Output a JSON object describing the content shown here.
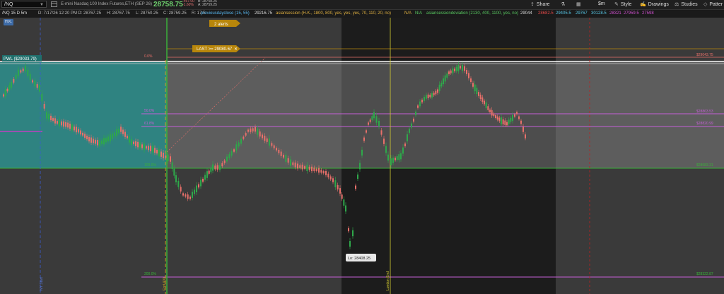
{
  "toolbar": {
    "symbol": "/NQ",
    "title": "E-mini Nasdaq 100 Index Futures,ETH (SEP 26)",
    "last_price": "28758.75",
    "net_change": "-467.00",
    "pct_change": "-1.60%",
    "bid": "B: 28758.25",
    "ask": "A: 28759.25",
    "share_label": "Share",
    "style_label": "Style",
    "drawings_label": "Drawings",
    "studies_label": "Studies",
    "patterns_label": "Patter",
    "dollar_label": "$m"
  },
  "info": {
    "chart_label": "/NQ 15 D 5m",
    "date": "D: 7/17/26 12:20 PM",
    "open": "O: 28767.25",
    "high": "H: 28767.75",
    "low": "L: 28750.25",
    "close": "C: 28759.25",
    "range": "R: 17.5",
    "study1": "previousdayclose (15, 55)",
    "study1_val": "29216.75",
    "study2": "asiansession (H.K., 1800, 800, yes, yes, yes, 70, 110, 20, no)",
    "na1": "N/A",
    "na2": "N/A",
    "study3": "asiansessiondeviation (2130, 400, 1100, yes, no)",
    "v1": "29044",
    "v2": "28682.5",
    "v3": "29405.5",
    "v4": "29767",
    "v5": "30128.5",
    "v6": "28321",
    "v7": "27959.5",
    "v8": "27598"
  },
  "badge": "H.K.",
  "chart": {
    "alerts": "2 alerts",
    "last_alert": "LAST >= 29080.67",
    "pwl": "PWL ($29033.79)",
    "fib_0": "0.0%",
    "fib_50": "50.0%",
    "fib_618": "61.8%",
    "fib_100": "100.0%",
    "fib_200": "200.0%",
    "price_top": "$29043.75",
    "price_50": "$28863.53",
    "price_618": "$28820.99",
    "price_100": "$28683.31",
    "price_200": "$28322.87",
    "lo_label": "Lo: 28408.25",
    "end_label": "End 400",
    "london_label": "London End",
    "left_vlabel": "NY Start"
  },
  "colors": {
    "up": "#2ea84a",
    "down": "#e8706a",
    "teal": "#2f8c8a",
    "gray_zone": "#5a5a5a",
    "fib": "#c55fd6",
    "gold": "#c8a020"
  }
}
